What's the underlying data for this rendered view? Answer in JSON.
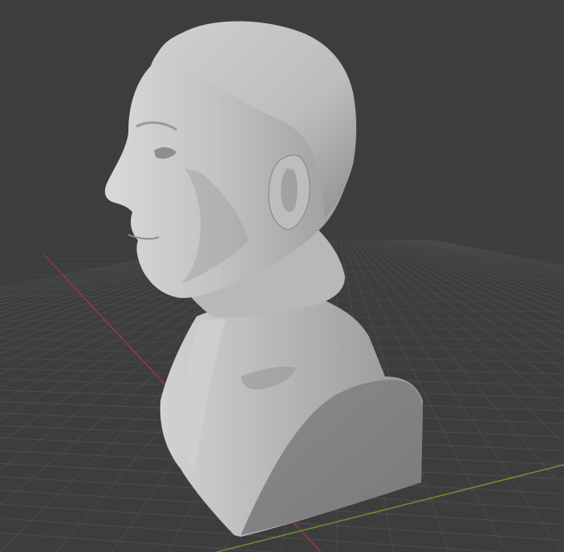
{
  "viewport": {
    "kind": "3d-viewport",
    "background_color": "#3d3d3d",
    "grid_visible": true,
    "grid_color": "#4d4d4d",
    "x_axis_color": "#8f3c43",
    "y_axis_color": "#6a8f2f"
  },
  "object": {
    "kind": "sculpted-bust",
    "shading": "solid",
    "base_color": "#a8a8a8",
    "highlight_color": "#d4d4d4",
    "shadow_color": "#6f6f6f"
  }
}
